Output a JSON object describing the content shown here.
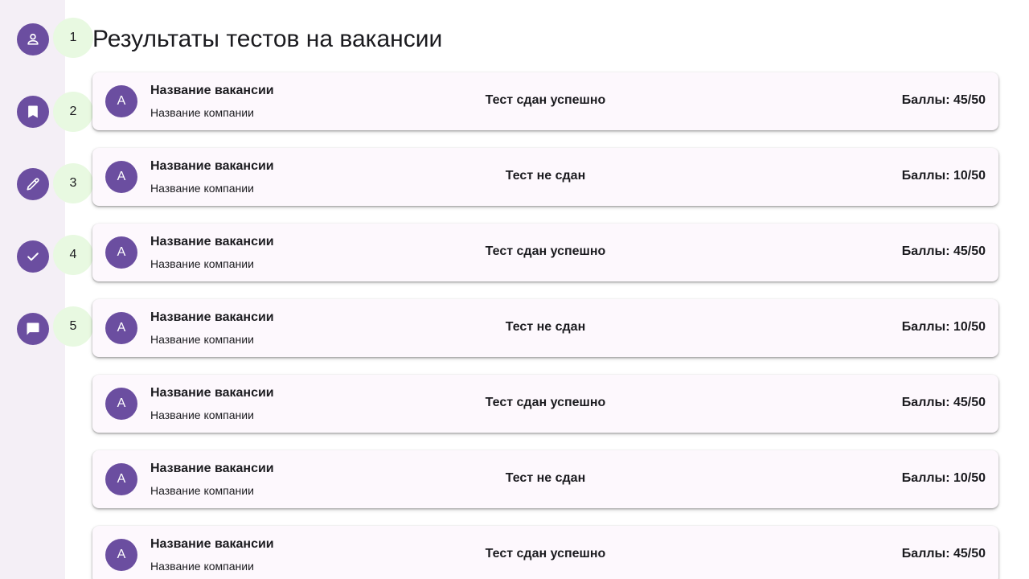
{
  "page": {
    "title": "Результаты тестов на вакансии"
  },
  "rail": {
    "items": [
      {
        "icon": "person-icon",
        "marker": "1"
      },
      {
        "icon": "bookmark-icon",
        "marker": "2"
      },
      {
        "icon": "pencil-icon",
        "marker": "3"
      },
      {
        "icon": "check-icon",
        "marker": "4"
      },
      {
        "icon": "chat-icon",
        "marker": "5"
      }
    ]
  },
  "results": [
    {
      "avatar": "A",
      "vacancy": "Название вакансии",
      "company": "Название компании",
      "status": "Тест сдан успешно",
      "score": "Баллы: 45/50"
    },
    {
      "avatar": "A",
      "vacancy": "Название вакансии",
      "company": "Название компании",
      "status": "Тест не сдан",
      "score": "Баллы: 10/50"
    },
    {
      "avatar": "A",
      "vacancy": "Название вакансии",
      "company": "Название компании",
      "status": "Тест сдан успешно",
      "score": "Баллы: 45/50"
    },
    {
      "avatar": "A",
      "vacancy": "Название вакансии",
      "company": "Название компании",
      "status": "Тест не сдан",
      "score": "Баллы: 10/50"
    },
    {
      "avatar": "A",
      "vacancy": "Название вакансии",
      "company": "Название компании",
      "status": "Тест сдан успешно",
      "score": "Баллы: 45/50"
    },
    {
      "avatar": "A",
      "vacancy": "Название вакансии",
      "company": "Название компании",
      "status": "Тест не сдан",
      "score": "Баллы: 10/50"
    },
    {
      "avatar": "A",
      "vacancy": "Название вакансии",
      "company": "Название компании",
      "status": "Тест сдан успешно",
      "score": "Баллы: 45/50"
    }
  ],
  "colors": {
    "accent": "#6b4ea0",
    "rail_background": "#f4eff6",
    "card_background": "#fdf8fd",
    "marker_background": "#e8f9e1"
  }
}
